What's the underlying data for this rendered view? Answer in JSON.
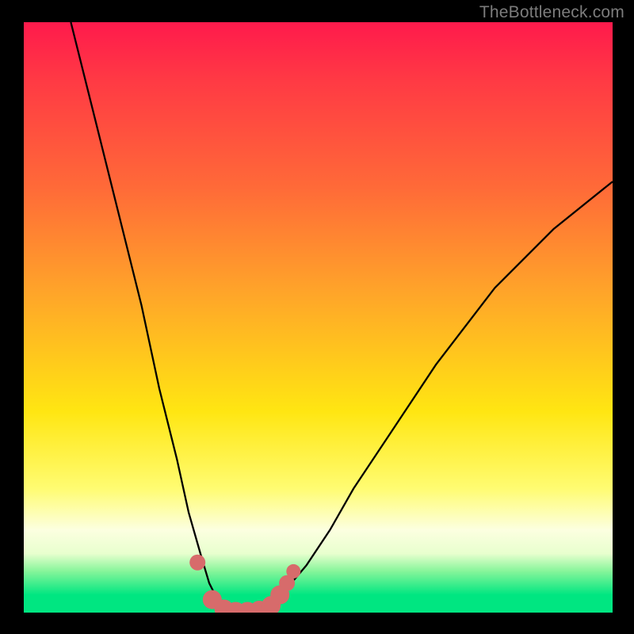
{
  "watermark": "TheBottleneck.com",
  "chart_data": {
    "type": "line",
    "title": "",
    "xlabel": "",
    "ylabel": "",
    "xlim": [
      0,
      100
    ],
    "ylim": [
      0,
      100
    ],
    "series": [
      {
        "name": "bottleneck-curve",
        "x": [
          8,
          12,
          16,
          20,
          23,
          26,
          28,
          30,
          31.5,
          33,
          35,
          37,
          39,
          41,
          43,
          45,
          48,
          52,
          56,
          62,
          70,
          80,
          90,
          100
        ],
        "values": [
          100,
          84,
          68,
          52,
          38,
          26,
          17,
          10,
          5,
          2,
          0,
          0,
          0,
          0.5,
          2,
          4.5,
          8,
          14,
          21,
          30,
          42,
          55,
          65,
          73
        ]
      }
    ],
    "markers": {
      "name": "highlight-points",
      "color": "#d76b6b",
      "x": [
        29.5,
        32,
        34,
        36,
        38,
        40,
        42,
        43.5,
        44.7,
        45.8
      ],
      "values": [
        8.5,
        2.2,
        0.6,
        0.2,
        0.2,
        0.4,
        1.2,
        3.0,
        5.0,
        7.0
      ],
      "size": [
        20,
        24,
        24,
        24,
        24,
        24,
        24,
        24,
        20,
        18
      ]
    }
  }
}
